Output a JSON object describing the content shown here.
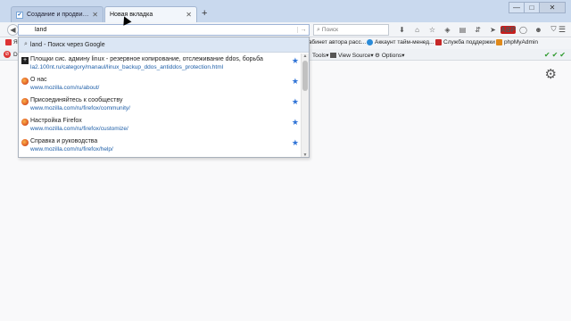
{
  "tabs": [
    {
      "title": "Создание и продвижение ...",
      "active": false
    },
    {
      "title": "Новая вкладка",
      "active": true
    }
  ],
  "new_tab_symbol": "+",
  "window_controls": {
    "minimize": "—",
    "maximize": "□",
    "close": "✕"
  },
  "nav": {
    "url_value": "land",
    "search_placeholder": "Поиск",
    "icons": [
      "download-icon",
      "home-icon",
      "bookmark-star-icon",
      "pocket-icon",
      "library-icon",
      "sync-icon",
      "send-icon",
      "adblock-icon",
      "chat-icon",
      "user-icon",
      "shield-icon",
      "menu-icon"
    ],
    "adblock_label": "ABP"
  },
  "bookmarks": [
    {
      "label": "Я"
    },
    {
      "label": "Кабинет автора расс..."
    },
    {
      "label": "Аккаунт тайм-менед..."
    },
    {
      "label": "Служба поддержки"
    },
    {
      "label": "phpMyAdmin"
    }
  ],
  "toolbar": [
    {
      "label": "D"
    },
    {
      "label": "Tools"
    },
    {
      "label": "View Source"
    },
    {
      "label": "Options"
    }
  ],
  "autocomplete": {
    "suggestion": "land - Поиск через Google",
    "results": [
      {
        "title": "Площки сис. админу linux - резервное копирование, отслеживание ddos, борьба",
        "url": "la2.100nt.ru/category/manaul/linux_backup_ddos_antiddos_protection.html",
        "icon": "sq"
      },
      {
        "title": "О нас",
        "url": "www.mozilla.com/ru/about/",
        "icon": "ff"
      },
      {
        "title": "Присоединяйтесь к сообществу",
        "url": "www.mozilla.com/ru/firefox/community/",
        "icon": "ff"
      },
      {
        "title": "Настройка Firefox",
        "url": "www.mozilla.com/ru/firefox/customize/",
        "icon": "ff"
      },
      {
        "title": "Справка и руководства",
        "url": "www.mozilla.com/ru/firefox/help/",
        "icon": "ff"
      }
    ]
  },
  "colors": {
    "accent": "#2f73d6",
    "titlebar": "#c9d9ee",
    "link": "#1d5ea8"
  }
}
